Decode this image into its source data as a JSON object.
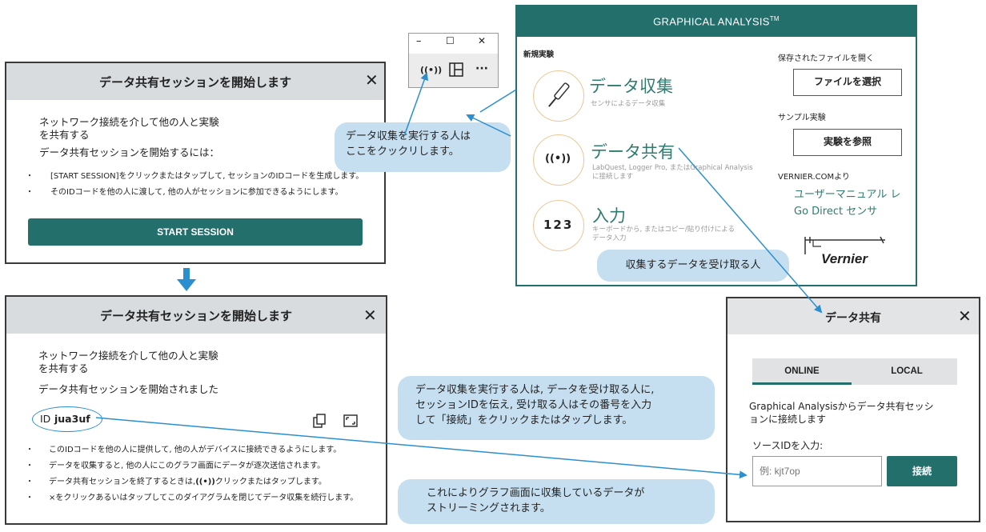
{
  "dialog1": {
    "title": "データ共有セッションを開始します",
    "close": "✕",
    "intro_line1": "ネットワーク接続を介して他の人と実験",
    "intro_line2": "を共有する",
    "how_to": "データ共有セッションを開始するには：",
    "bullet1": "[START SESSION]をクリックまたはタップして, セッションのIDコードを生成します。",
    "bullet2": "そのIDコードを他の人に渡して, 他の人がセッションに参加できるようにします。",
    "start_button": "START SESSION"
  },
  "dialog2": {
    "title": "データ共有セッションを開始します",
    "close": "✕",
    "intro_line1": "ネットワーク接続を介して他の人と実験",
    "intro_line2": "を共有する",
    "started": "データ共有セッションを開始されました",
    "id_label": "ID",
    "id_value": "jua3uf",
    "bullet1": "このIDコードを他の人に提供して, 他の人がデバイスに接続できるようにします。",
    "bullet2": "データを収集すると, 他の人にこのグラフ画面にデータが逐次送信されます。",
    "bullet3_a": "データ共有セッションを終了するときは,",
    "bullet3_icon": "((•))",
    "bullet3_b": "クリックまたはタップします。",
    "bullet4": "×をクリックあるいはタップしてこのダイアグラムを閉じてデータ収集を続行します。"
  },
  "window_controls": {
    "minimize": "–",
    "maximize": "☐",
    "close": "✕",
    "share_icon": "((•))",
    "layout_icon": "layout-icon",
    "more": "···"
  },
  "ga": {
    "title": "GRAPHICAL ANALYSIS",
    "tm": "TM",
    "new_experiment": "新規実験",
    "collect_title": "データ収集",
    "collect_sub": "センサによるデータ収集",
    "share_title": "データ共有",
    "share_sub1": "LabQuest, Logger Pro, またはGraphical Analysis",
    "share_sub2": "に接続します",
    "input_title": "入力",
    "input_icon": "123",
    "input_sub1": "キーボードから, またはコピー/貼り付けによる",
    "input_sub2": "データ入力",
    "open_saved": "保存されたファイルを開く",
    "choose_file": "ファイルを選択",
    "sample": "サンプル実験",
    "browse": "実験を参照",
    "vernier_from": "VERNIER.COMより",
    "user_manual": "ユーザーマニュアル レ",
    "go_direct": "Go Direct センサ",
    "logo": "Vernier"
  },
  "share_dialog": {
    "title": "データ共有",
    "close": "✕",
    "tab_online": "ONLINE",
    "tab_local": "LOCAL",
    "desc1": "Graphical Analysisからデータ共有セッシ",
    "desc2": "ョンに接続します",
    "source_label": "ソースIDを入力:",
    "placeholder": "例: kjt7op",
    "connect": "接続"
  },
  "callouts": {
    "c1_line1": "データ収集を実行する人は",
    "c1_line2": "ここをクックリします。",
    "c2": "収集するデータを受け取る人",
    "c3_line1": "データ収集を実行する人は, データを受け取る人に,",
    "c3_line2": "セッションIDを伝え, 受け取る人はその番号を入力",
    "c3_line3": "して「接続」をクリックまたはタップします。",
    "c4_line1": "これによりグラフ画面に収集しているデータが",
    "c4_line2": "ストリーミングされます。"
  },
  "colors": {
    "teal": "#226f6c",
    "arrow": "#2b8fcf",
    "bubble": "#c6dff0"
  }
}
